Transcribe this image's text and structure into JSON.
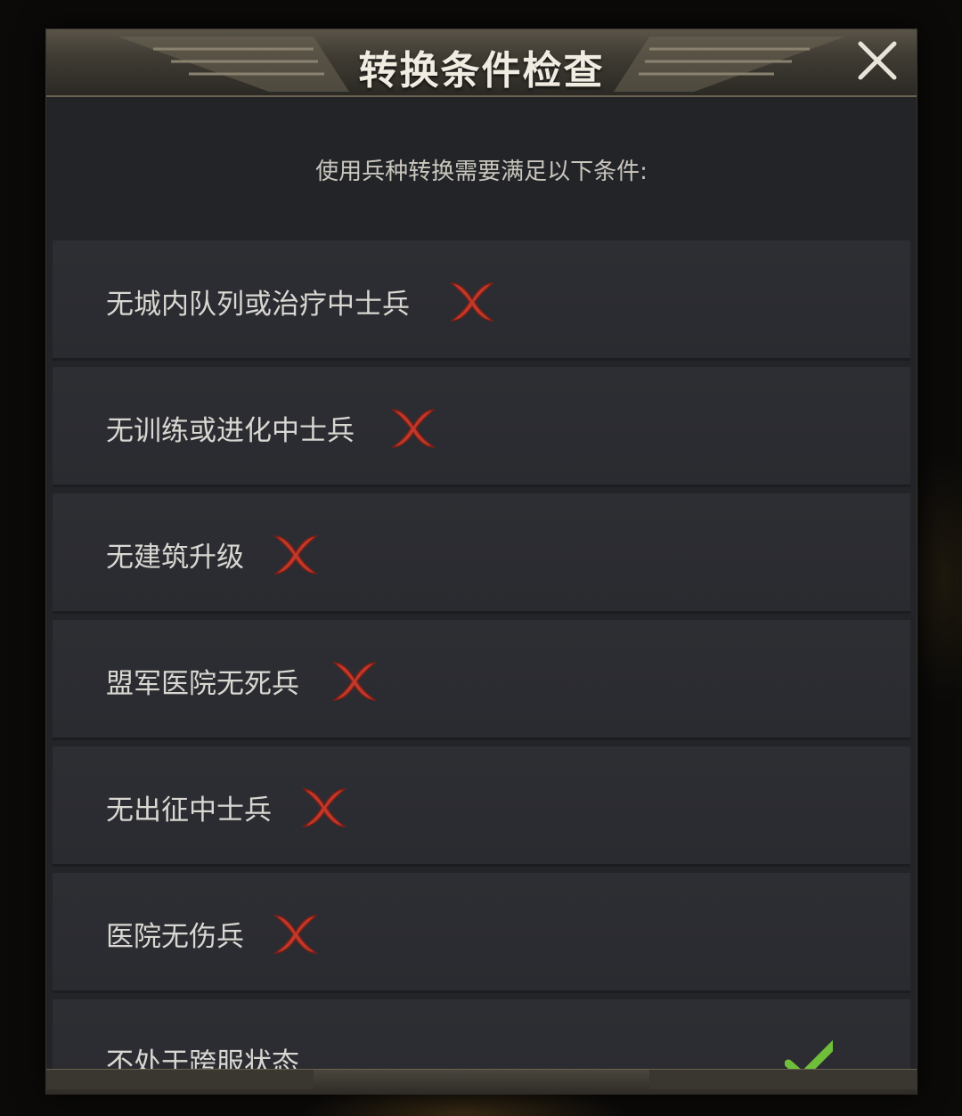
{
  "dialog": {
    "title": "转换条件检查",
    "subtitle": "使用兵种转换需要满足以下条件:",
    "close_icon": "close-icon"
  },
  "conditions": [
    {
      "label": "无城内队列或治疗中士兵",
      "status": "fail"
    },
    {
      "label": "无训练或进化中士兵",
      "status": "fail"
    },
    {
      "label": "无建筑升级",
      "status": "fail"
    },
    {
      "label": "盟军医院无死兵",
      "status": "fail"
    },
    {
      "label": "无出征中士兵",
      "status": "fail"
    },
    {
      "label": "医院无伤兵",
      "status": "fail"
    },
    {
      "label": "不处于跨服状态",
      "status": "pass"
    }
  ],
  "colors": {
    "fail": "#c0392b",
    "pass": "#6fbf3a",
    "title": "#f0ece2"
  }
}
